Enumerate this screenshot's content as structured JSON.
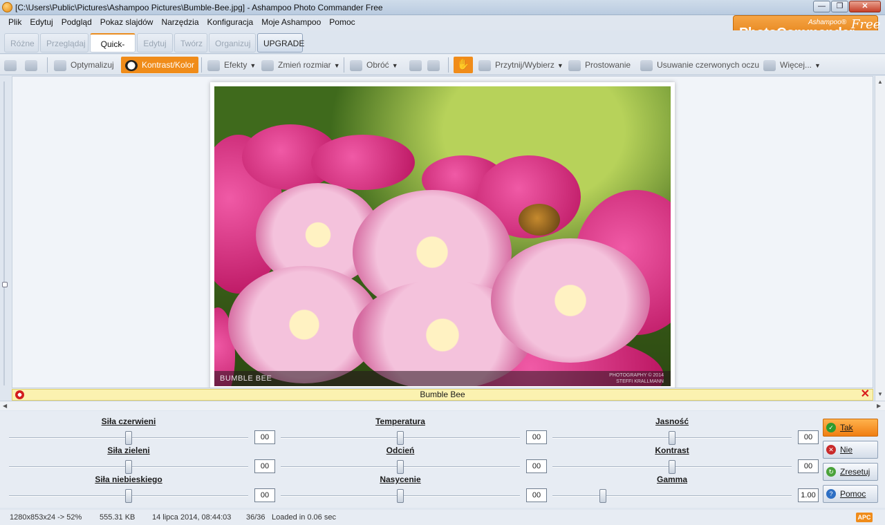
{
  "window": {
    "title": "[C:\\Users\\Public\\Pictures\\Ashampoo Pictures\\Bumble-Bee.jpg] - Ashampoo Photo Commander Free",
    "minimize": "—",
    "maximize": "❐",
    "close": "✕"
  },
  "menu": [
    "Plik",
    "Edytuj",
    "Podgląd",
    "Pokaz slajdów",
    "Narzędzia",
    "Konfiguracja",
    "Moje Ashampoo",
    "Pomoc"
  ],
  "logo": {
    "sub": "Ashampoo®",
    "main": "PhotoCommander",
    "free": "Free"
  },
  "tabs": [
    "Różne",
    "Przeglądaj",
    "Quick-Fix",
    "Edytuj",
    "Twórz",
    "Organizuj",
    "UPGRADE"
  ],
  "toolbar": {
    "optimize": "Optymalizuj",
    "contrast_color": "Kontrast/Kolor",
    "effects": "Efekty",
    "resize": "Zmień rozmiar",
    "rotate": "Obróć",
    "hand": "✋",
    "crop_select": "Przytnij/Wybierz",
    "straighten": "Prostowanie",
    "redeye": "Usuwanie czerwonych oczu",
    "more": "Więcej..."
  },
  "photo": {
    "caption": "BUMBLE BEE",
    "credit_line1": "PHOTOGRAPHY © 2014",
    "credit_line2": "STEFFI KRALLMANN"
  },
  "caption_strip": "Bumble Bee",
  "adjustments": [
    {
      "label": "Siła czerwieni",
      "value": "00",
      "level": 0.5
    },
    {
      "label": "Temperatura",
      "value": "00",
      "level": 0.5
    },
    {
      "label": "Jasność",
      "value": "00",
      "level": 0.5
    },
    {
      "label": "Siła zieleni",
      "value": "00",
      "level": 0.5
    },
    {
      "label": "Odcień",
      "value": "00",
      "level": 0.5
    },
    {
      "label": "Kontrast",
      "value": "00",
      "level": 0.5
    },
    {
      "label": "Siła niebieskiego",
      "value": "00",
      "level": 0.5
    },
    {
      "label": "Nasycenie",
      "value": "00",
      "level": 0.5
    },
    {
      "label": "Gamma",
      "value": "1.00",
      "level": 0.21
    }
  ],
  "buttons": {
    "yes": "Tak",
    "no": "Nie",
    "reset": "Zresetuj",
    "help": "Pomoc"
  },
  "status": {
    "dimensions": "1280x853x24 -> 52%",
    "size": "555.31 KB",
    "date": "14 lipca 2014, 08:44:03",
    "count": "36/36",
    "loaded": "Loaded in 0.06 sec",
    "badge": "APC"
  },
  "colors": {
    "accent": "#f08c1a",
    "caption_strip": "#fbf2b0",
    "close_red": "#d81c1c"
  }
}
